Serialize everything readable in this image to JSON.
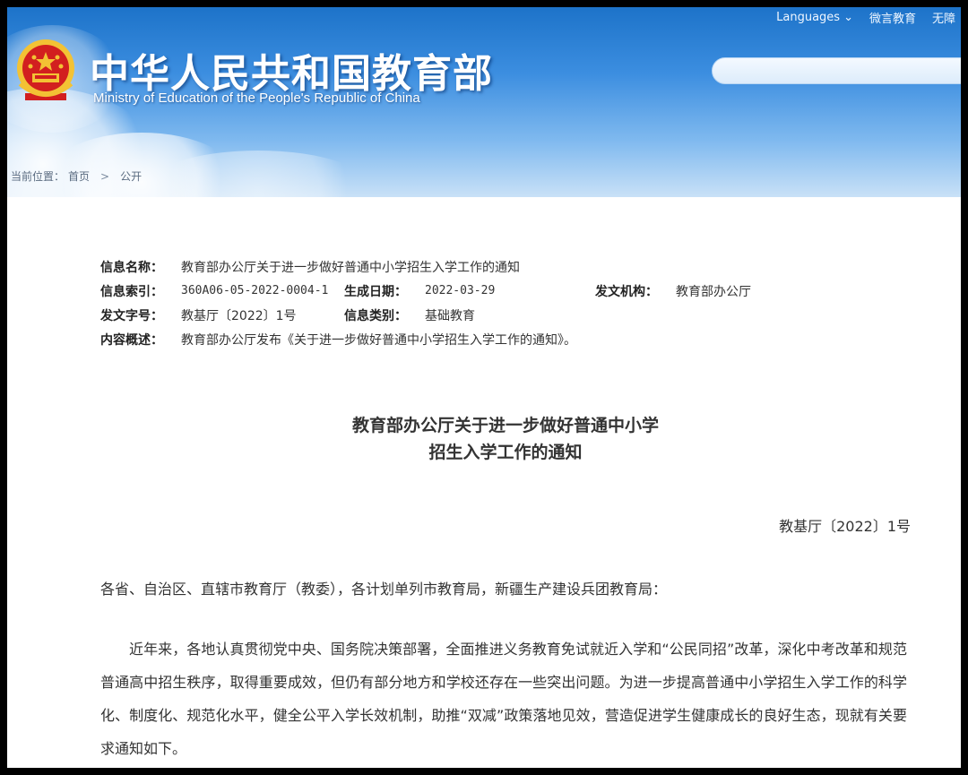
{
  "header": {
    "languages": "Languages",
    "weibo": "微言教育",
    "accessibility": "无障",
    "site_title": "中华人民共和国教育部",
    "site_subtitle": "Ministry of Education of the People's Republic of China"
  },
  "breadcrumb": {
    "prefix": "当前位置：",
    "home": "首页",
    "current": "公开"
  },
  "meta": {
    "name_label": "信息名称：",
    "name_value": "教育部办公厅关于进一步做好普通中小学招生入学工作的通知",
    "index_label": "信息索引：",
    "index_value": "360A06-05-2022-0004-1",
    "date_label": "生成日期：",
    "date_value": "2022-03-29",
    "org_label": "发文机构：",
    "org_value": "教育部办公厅",
    "docno_label": "发文字号：",
    "docno_value": "教基厅〔2022〕1号",
    "category_label": "信息类别：",
    "category_value": "基础教育",
    "summary_label": "内容概述：",
    "summary_value": "教育部办公厅发布《关于进一步做好普通中小学招生入学工作的通知》。"
  },
  "document": {
    "title_line1": "教育部办公厅关于进一步做好普通中小学",
    "title_line2": "招生入学工作的通知",
    "number": "教基厅〔2022〕1号",
    "salutation": "各省、自治区、直辖市教育厅（教委），各计划单列市教育局，新疆生产建设兵团教育局：",
    "paragraph1": "近年来，各地认真贯彻党中央、国务院决策部署，全面推进义务教育免试就近入学和“公民同招”改革，深化中考改革和规范普通高中招生秩序，取得重要成效，但仍有部分地方和学校还存在一些突出问题。为进一步提高普通中小学招生入学工作的科学化、制度化、规范化水平，健全公平入学长效机制，助推“双减”政策落地见效，营造促进学生健康成长的良好生态，现就有关要求通知如下。"
  },
  "colors": {
    "header_blue": "#1d73c9",
    "emblem_red": "#d21f1f",
    "emblem_gold": "#f3c234"
  }
}
